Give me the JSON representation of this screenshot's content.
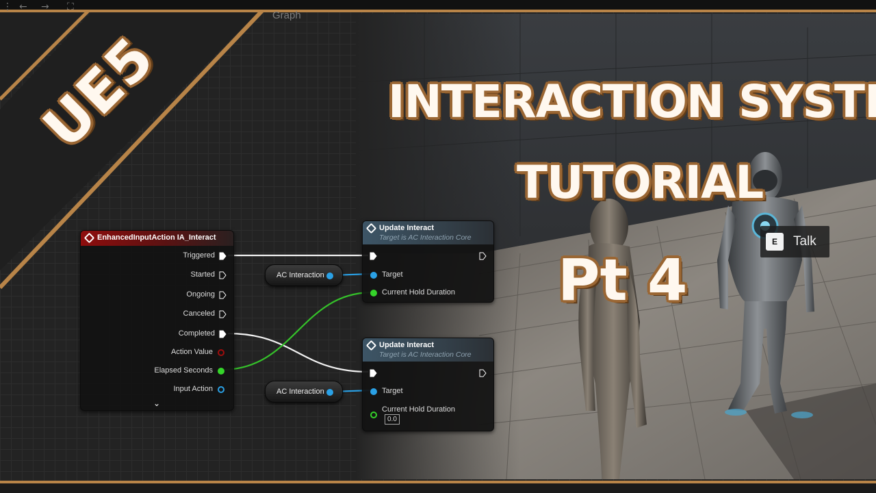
{
  "toolbar": {
    "back_icon": "arrow-left-icon",
    "forward_icon": "arrow-right-icon",
    "graph_label": "Graph"
  },
  "logo": {
    "text": "UE5"
  },
  "title": {
    "line1": "INTERACTION SYSTEM",
    "line2": "TUTORIAL",
    "part": "Pt 4"
  },
  "event_node": {
    "title": "EnhancedInputAction IA_Interact",
    "pins": [
      "Triggered",
      "Started",
      "Ongoing",
      "Canceled",
      "Completed",
      "Action Value",
      "Elapsed Seconds",
      "Input Action"
    ],
    "expand_icon": "chevron-down-icon"
  },
  "update_node_1": {
    "title": "Update Interact",
    "subtitle": "Target is AC Interaction Core",
    "target": "Target",
    "duration": "Current Hold Duration"
  },
  "update_node_2": {
    "title": "Update Interact",
    "subtitle": "Target is AC Interaction Core",
    "target": "Target",
    "duration": "Current Hold Duration",
    "duration_value": "0.0"
  },
  "var_nodes": [
    "AC Interaction",
    "AC Interaction"
  ],
  "prompt": {
    "key": "E",
    "label": "Talk"
  },
  "colors": {
    "accent": "#b88448",
    "exec": "#ffffff",
    "object_pin": "#2aa1e6",
    "float_pin": "#35d42a",
    "event_header": "#8e0d0d"
  }
}
